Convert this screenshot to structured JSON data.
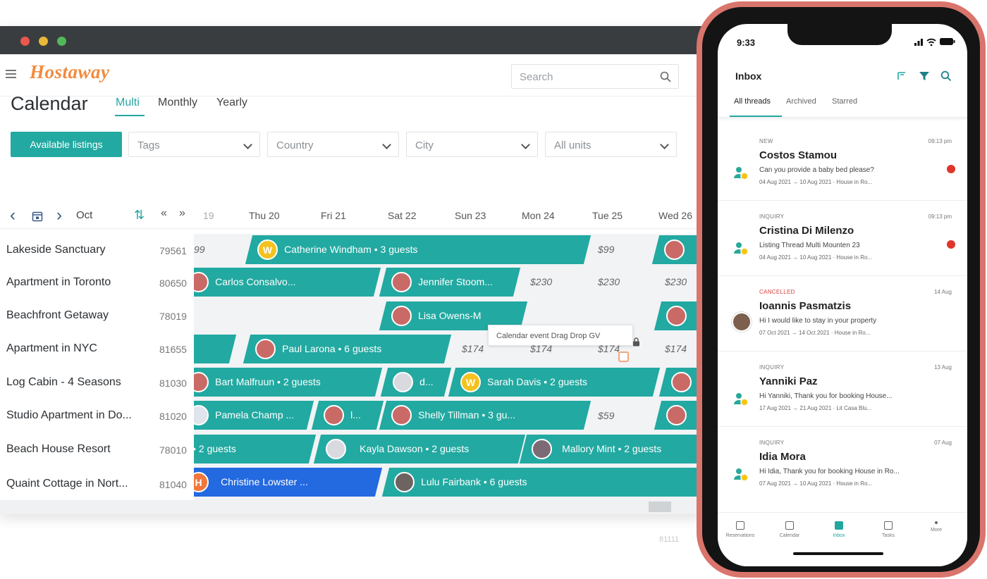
{
  "colors": {
    "accent": "#22a9a1",
    "brand_logo": "#f28b3c",
    "blue_booking": "#2369e0",
    "unread": "#e0352b",
    "phone_frame": "#d9756c"
  },
  "app": {
    "logo": "Hostaway"
  },
  "search": {
    "placeholder": "Search"
  },
  "calendar": {
    "title": "Calendar",
    "views": [
      "Multi",
      "Monthly",
      "Yearly"
    ],
    "available_button": "Available listings",
    "filters": [
      "Tags",
      "Country",
      "City",
      "All units"
    ],
    "nav": {
      "prev": "‹",
      "next": "›",
      "fast_back": "«",
      "fast_forward": "»",
      "month": "Oct",
      "sort_glyph": "⇅"
    },
    "days": [
      "19",
      "Thu 20",
      "Fri 21",
      "Sat 22",
      "Sun 23",
      "Mon 24",
      "Tue 25",
      "Wed 26"
    ],
    "listings": [
      {
        "name": "Lakeside Sanctuary",
        "id": "79561"
      },
      {
        "name": "Apartment in Toronto",
        "id": "80650"
      },
      {
        "name": "Beachfront Getaway",
        "id": "78019"
      },
      {
        "name": "Apartment in NYC",
        "id": "81655"
      },
      {
        "name": "Log Cabin - 4 Seasons",
        "id": "81030"
      },
      {
        "name": "Studio Apartment in Do...",
        "id": "81020"
      },
      {
        "name": "Beach House Resort",
        "id": "78010"
      },
      {
        "name": "Quaint Cottage in Nort...",
        "id": "81040"
      }
    ],
    "reservations": [
      {
        "label": "Catherine Windham • 3 guests",
        "avatar": "W"
      },
      {
        "label": "Carlos Consalvo...",
        "avatar": ""
      },
      {
        "label": "Jennifer Stoom...",
        "avatar": ""
      },
      {
        "label": "Lisa Owens-M",
        "avatar": ""
      },
      {
        "label": "Paul Larona • 6 guests",
        "avatar": ""
      },
      {
        "label": "Bart Malfruun • 2 guests",
        "avatar": ""
      },
      {
        "label": "d...",
        "avatar": ""
      },
      {
        "label": "Sarah Davis • 2 guests",
        "avatar": "W"
      },
      {
        "label": "Pamela Champ ...",
        "avatar": ""
      },
      {
        "label": "l...",
        "avatar": ""
      },
      {
        "label": "Shelly Tillman • 3 gu...",
        "avatar": ""
      },
      {
        "label": "• 2 guests",
        "avatar": ""
      },
      {
        "label": "Kayla Dawson • 2 guests",
        "avatar": ""
      },
      {
        "label": "Mallory Mint • 2 guests",
        "avatar": ""
      },
      {
        "label": "Christine Lowster ...",
        "avatar": "H"
      },
      {
        "label": "Lulu Fairbank • 6 guests",
        "avatar": ""
      }
    ],
    "prices": {
      "p99": "$99",
      "p230": "$230",
      "p174": "$174",
      "p59": "$59",
      "p_edge": "99"
    },
    "tooltip": "Calendar event Drag Drop GV",
    "footer_id": "81111"
  },
  "phone": {
    "time": "9:33",
    "inbox_title": "Inbox",
    "tabs": [
      "All threads",
      "Archived",
      "Starred"
    ],
    "messages": [
      {
        "status": "NEW",
        "time": "09:13 pm",
        "name": "Costos Stamou",
        "preview": "Can you provide a baby bed please?",
        "dates": "04 Aug 2021 → 10 Aug 2021 · House in Ro...",
        "unread": true
      },
      {
        "status": "INQUIRY",
        "time": "09:13 pm",
        "name": "Cristina Di Milenzo",
        "preview": "Listing Thread Multi Mounten 23",
        "dates": "04 Aug 2021 → 10 Aug 2021 · House in Ro...",
        "unread": true
      },
      {
        "status": "CANCELLED",
        "time": "14 Aug",
        "name": "Ioannis Pasmatzis",
        "preview": "Hi I would like to stay in your property",
        "dates": "07 Oct 2021 → 14 Oct 2021 · House in Ro...",
        "unread": false
      },
      {
        "status": "INQUIRY",
        "time": "13 Aug",
        "name": "Yanniki Paz",
        "preview": "Hi Yanniki, Thank you for booking House...",
        "dates": "17 Aug 2021 → 21 Aug 2021 · Lit Casa Blu...",
        "unread": false
      },
      {
        "status": "INQUIRY",
        "time": "07 Aug",
        "name": "Idia Mora",
        "preview": "Hi Idia, Thank you for booking House in Ro...",
        "dates": "07 Aug 2021 → 10 Aug 2021 · House in Ro...",
        "unread": false
      }
    ],
    "bottom_nav": [
      "Reservations",
      "Calendar",
      "Inbox",
      "Tasks",
      "More"
    ]
  }
}
